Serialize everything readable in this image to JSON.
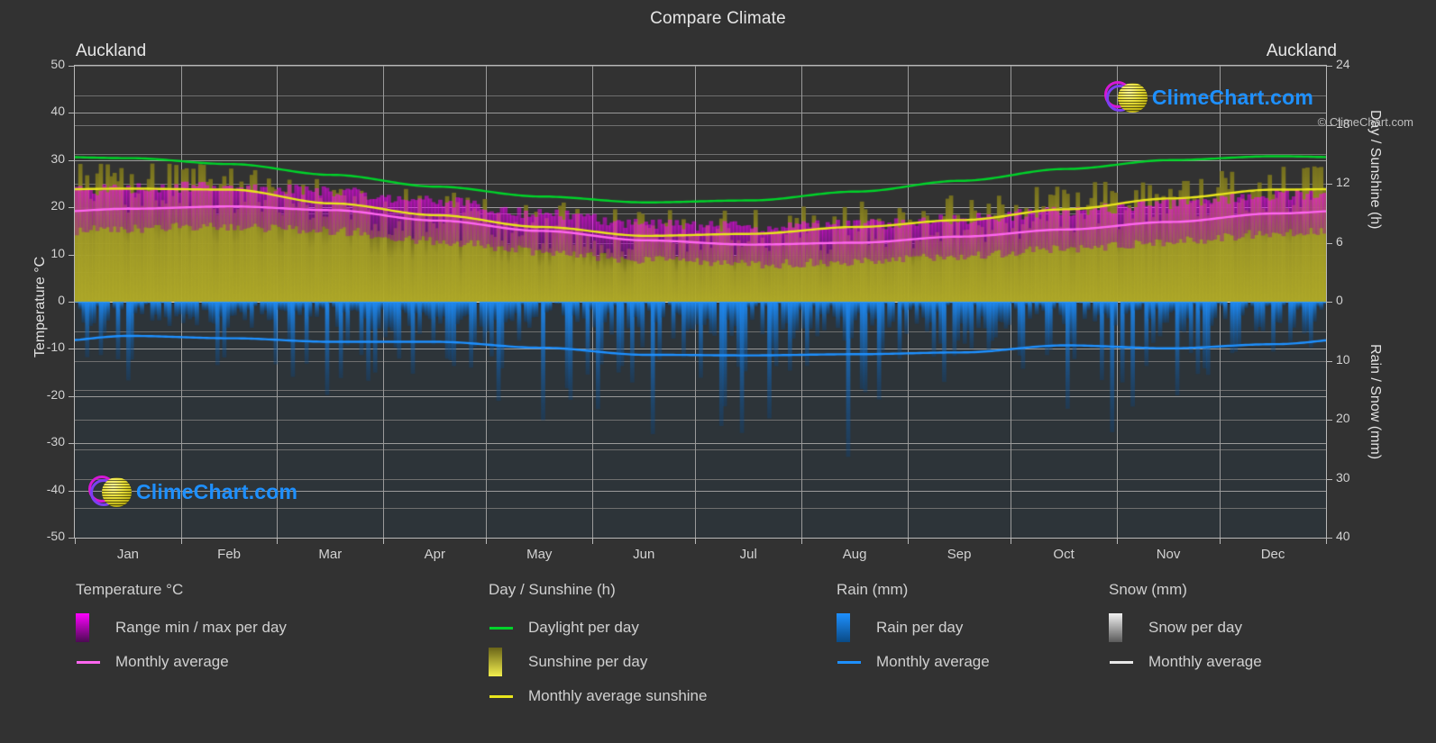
{
  "header": {
    "title": "Compare Climate",
    "location_left": "Auckland",
    "location_right": "Auckland"
  },
  "brand": {
    "name": "ClimeChart.com",
    "copyright": "© ClimeChart.com",
    "word_color": "#1e90ff",
    "ring_color": "#d617d6",
    "sphere_color": "#e8df3a"
  },
  "axes": {
    "left_title": "Temperature °C",
    "right_title_top": "Day / Sunshine (h)",
    "right_title_bottom": "Rain / Snow (mm)",
    "left_ticks": [
      "50",
      "40",
      "30",
      "20",
      "10",
      "0",
      "-10",
      "-20",
      "-30",
      "-40",
      "-50"
    ],
    "right_ticks_top": [
      "24",
      "18",
      "12",
      "6",
      "0"
    ],
    "right_ticks_bottom": [
      "10",
      "20",
      "30",
      "40"
    ],
    "x_ticks": [
      "Jan",
      "Feb",
      "Mar",
      "Apr",
      "May",
      "Jun",
      "Jul",
      "Aug",
      "Sep",
      "Oct",
      "Nov",
      "Dec"
    ]
  },
  "legend": {
    "columns": [
      {
        "heading": "Temperature °C",
        "entries": [
          {
            "label": "Range min / max per day",
            "type": "gradient-box",
            "color": "#ff00ff",
            "color2": "#4b0a52"
          },
          {
            "label": "Monthly average",
            "type": "line",
            "color": "#ff66f0"
          }
        ]
      },
      {
        "heading": "Day / Sunshine (h)",
        "entries": [
          {
            "label": "Daylight per day",
            "type": "line",
            "color": "#00d32a"
          },
          {
            "label": "Sunshine per day",
            "type": "gradient-box",
            "color": "#6a6418",
            "color2": "#f2ee4e"
          },
          {
            "label": "Monthly average sunshine",
            "type": "line",
            "color": "#e8e51c"
          }
        ]
      },
      {
        "heading": "Rain (mm)",
        "entries": [
          {
            "label": "Rain per day",
            "type": "gradient-box",
            "color": "#1e90ff",
            "color2": "#0a4a85"
          },
          {
            "label": "Monthly average",
            "type": "line",
            "color": "#1e90ff"
          }
        ]
      },
      {
        "heading": "Snow (mm)",
        "entries": [
          {
            "label": "Snow per day",
            "type": "gradient-box",
            "color": "#f2f2f2",
            "color2": "#5a5a5a"
          },
          {
            "label": "Monthly average",
            "type": "line",
            "color": "#e8e8e8"
          }
        ]
      }
    ]
  },
  "chart_data": {
    "type": "area",
    "title": "Compare Climate",
    "subtitle": "Auckland",
    "xlabel": "",
    "ylabel": "Temperature °C",
    "y2label_top": "Day / Sunshine (h)",
    "y2label_bottom": "Rain / Snow (mm)",
    "grid": true,
    "legend_position": "below",
    "categories": [
      "Jan",
      "Feb",
      "Mar",
      "Apr",
      "May",
      "Jun",
      "Jul",
      "Aug",
      "Sep",
      "Oct",
      "Nov",
      "Dec"
    ],
    "ylim": [
      -50,
      50
    ],
    "y2lim_top": [
      0,
      24
    ],
    "y2lim_bottom": [
      0,
      40
    ],
    "series": [
      {
        "name": "Daylight per day",
        "unit": "h",
        "color": "#00d32a",
        "axis": "right-top",
        "values": [
          14.6,
          14.0,
          12.9,
          11.7,
          10.7,
          10.1,
          10.3,
          11.2,
          12.3,
          13.5,
          14.4,
          14.8
        ]
      },
      {
        "name": "Monthly average sunshine",
        "unit": "h",
        "color": "#e8e51c",
        "axis": "right-top",
        "values": [
          11.5,
          11.4,
          10.0,
          8.8,
          7.6,
          6.7,
          6.9,
          7.6,
          8.3,
          9.4,
          10.5,
          11.4
        ]
      },
      {
        "name": "Monthly average temperature",
        "unit": "°C",
        "color": "#ff66f0",
        "axis": "left",
        "values": [
          19.7,
          20.2,
          19.4,
          17.2,
          15.0,
          13.0,
          12.1,
          12.5,
          13.8,
          15.3,
          16.9,
          18.7
        ]
      },
      {
        "name": "Range min / max per day",
        "unit": "°C",
        "color": "#ff00ff",
        "axis": "left",
        "min": [
          15.5,
          16.0,
          15.0,
          12.8,
          10.7,
          8.8,
          7.9,
          8.3,
          9.8,
          11.2,
          12.7,
          14.5
        ],
        "max": [
          24.0,
          24.4,
          23.4,
          21.2,
          18.6,
          16.6,
          15.8,
          16.3,
          17.6,
          19.1,
          20.8,
          22.6
        ]
      },
      {
        "name": "Monthly average rain",
        "unit": "mm",
        "color": "#1e90ff",
        "axis": "right-bottom",
        "values": [
          5.8,
          6.2,
          6.8,
          6.8,
          7.8,
          9.0,
          9.1,
          8.9,
          8.6,
          7.4,
          7.9,
          7.2
        ]
      },
      {
        "name": "Snow per day",
        "unit": "mm",
        "color": "#e8e8e8",
        "axis": "right-bottom",
        "values": [
          0,
          0,
          0,
          0,
          0,
          0,
          0,
          0,
          0,
          0,
          0,
          0
        ]
      }
    ]
  }
}
